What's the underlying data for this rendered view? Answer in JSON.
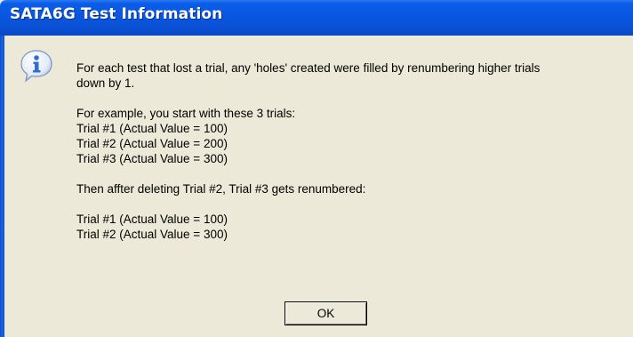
{
  "window": {
    "title": "SATA6G Test Information"
  },
  "icons": {
    "message_icon": "information-icon"
  },
  "message": {
    "paragraph1": [
      "For each test that lost a trial, any 'holes' created were filled by renumbering higher trials",
      "down by 1."
    ],
    "example_intro": "For example, you start with these 3 trials:",
    "before": [
      "Trial #1 (Actual Value = 100)",
      "Trial #2 (Actual Value = 200)",
      "Trial #3 (Actual Value = 300)"
    ],
    "then_line": "Then affter deleting Trial #2, Trial #3 gets renumbered:",
    "after": [
      "Trial #1 (Actual Value = 100)",
      "Trial #2 (Actual Value = 300)"
    ]
  },
  "buttons": {
    "ok_label": "OK"
  },
  "colors": {
    "title_bar": "#0a55de",
    "dialog_background": "#ece9d8",
    "icon_fill": "#2f6fd0"
  }
}
